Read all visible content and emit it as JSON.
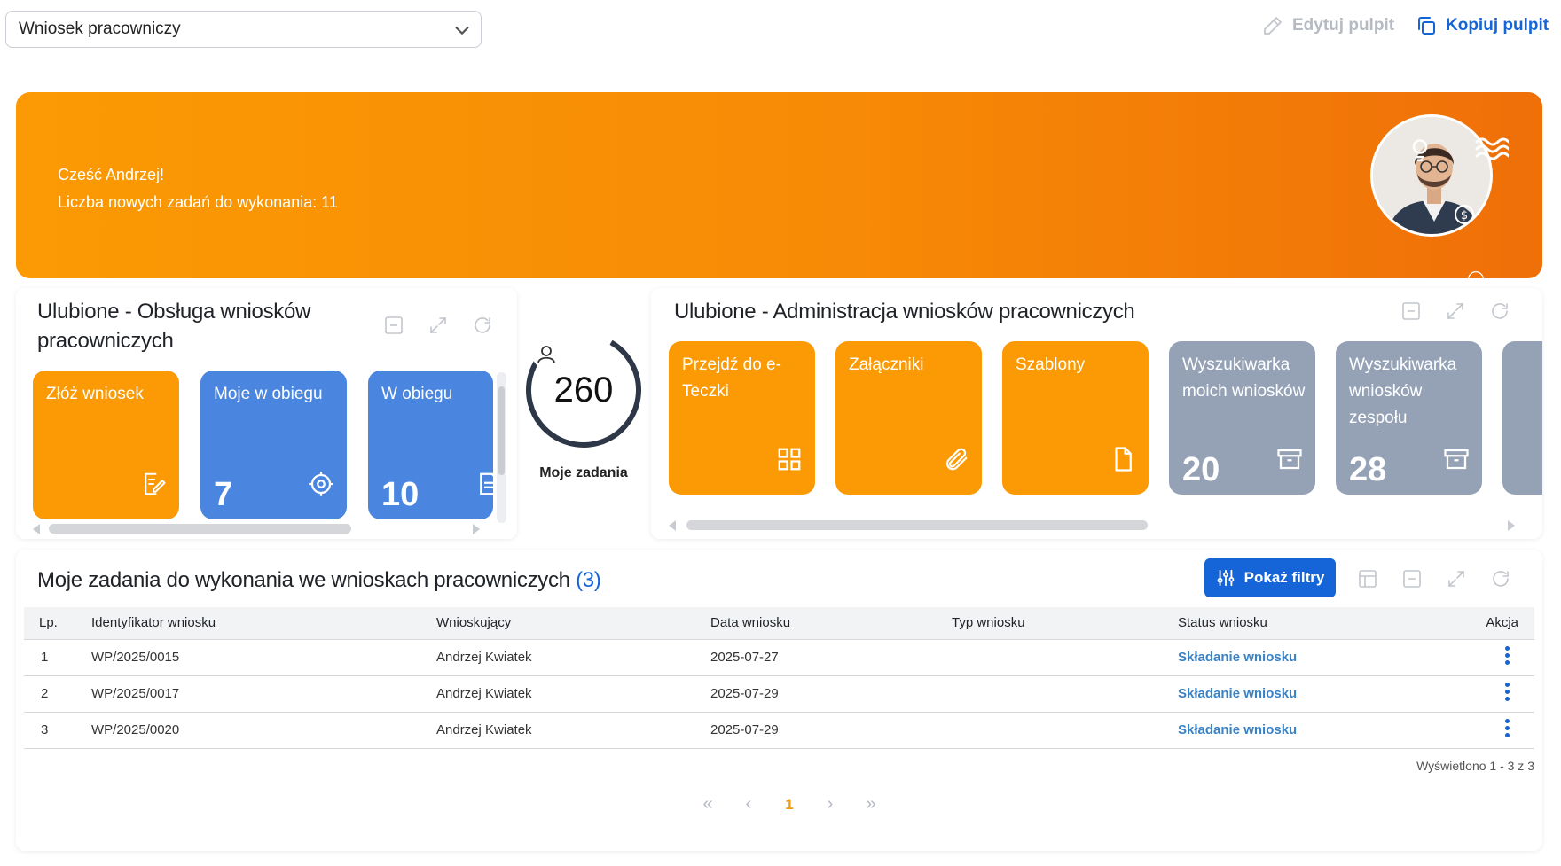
{
  "topbar": {
    "dashboard_select": "Wniosek pracowniczy",
    "edit_label": "Edytuj pulpit",
    "copy_label": "Kopiuj pulpit"
  },
  "banner": {
    "greeting": "Cześć Andrzej!",
    "tasks_line": "Liczba nowych zadań do wykonania: 11"
  },
  "fav_service": {
    "title": "Ulubione - Obsługa wniosków pracowniczych",
    "tiles": [
      {
        "label": "Złóż wniosek",
        "number": "",
        "icon": "edit-document-icon",
        "color": "#fb9a04"
      },
      {
        "label": "Moje w obiegu",
        "number": "7",
        "icon": "target-icon",
        "color": "#4a86e0"
      },
      {
        "label": "W obiegu",
        "number": "10",
        "icon": "document-icon",
        "color": "#4a86e0"
      }
    ]
  },
  "gauge": {
    "value": "260",
    "label": "Moje zadania"
  },
  "fav_admin": {
    "title": "Ulubione - Administracja wniosków pracowniczych",
    "tiles": [
      {
        "label": "Przejdź do e-Teczki",
        "number": "",
        "icon": "grid-icon",
        "color": "#fb9a04"
      },
      {
        "label": "Załączniki",
        "number": "",
        "icon": "paperclip-icon",
        "color": "#fb9a04"
      },
      {
        "label": "Szablony",
        "number": "",
        "icon": "file-icon",
        "color": "#fb9a04"
      },
      {
        "label": "Wyszukiwarka moich wniosków",
        "number": "20",
        "icon": "archive-icon",
        "color": "#95a2b6"
      },
      {
        "label": "Wyszukiwarka wniosków zespołu",
        "number": "28",
        "icon": "archive-icon",
        "color": "#95a2b6"
      }
    ]
  },
  "tasks": {
    "title": "Moje zadania do wykonania we wnioskach pracowniczych",
    "count": "(3)",
    "filter_button": "Pokaż filtry",
    "columns": [
      "Lp.",
      "Identyfikator wniosku",
      "Wnioskujący",
      "Data wniosku",
      "Typ wniosku",
      "Status wniosku",
      "Akcja"
    ],
    "rows": [
      {
        "lp": "1",
        "id": "WP/2025/0015",
        "requester": "Andrzej Kwiatek",
        "date": "2025-07-27",
        "type": "",
        "status": "Składanie wniosku"
      },
      {
        "lp": "2",
        "id": "WP/2025/0017",
        "requester": "Andrzej Kwiatek",
        "date": "2025-07-29",
        "type": "",
        "status": "Składanie wniosku"
      },
      {
        "lp": "3",
        "id": "WP/2025/0020",
        "requester": "Andrzej Kwiatek",
        "date": "2025-07-29",
        "type": "",
        "status": "Składanie wniosku"
      }
    ],
    "summary": "Wyświetlono 1 - 3 z 3",
    "current_page": "1"
  },
  "colors": {
    "accent": "#1565d8",
    "orange": "#fb9a04",
    "tile_blue": "#4a86e0",
    "tile_gray": "#95a2b6",
    "status": "#3b82c4"
  }
}
